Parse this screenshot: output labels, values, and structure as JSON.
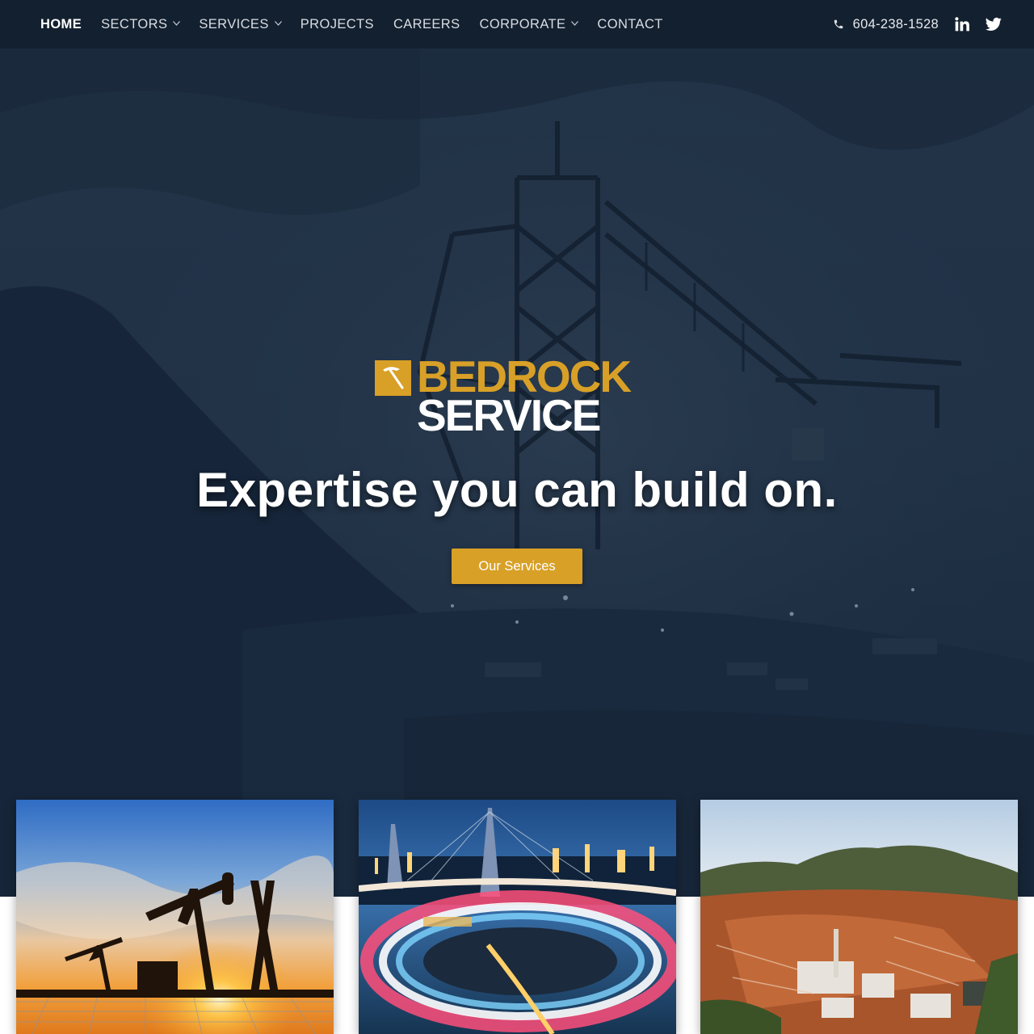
{
  "nav": {
    "items": [
      {
        "label": "HOME",
        "active": true,
        "has_dropdown": false
      },
      {
        "label": "SECTORS",
        "active": false,
        "has_dropdown": true
      },
      {
        "label": "SERVICES",
        "active": false,
        "has_dropdown": true
      },
      {
        "label": "PROJECTS",
        "active": false,
        "has_dropdown": false
      },
      {
        "label": "CAREERS",
        "active": false,
        "has_dropdown": false
      },
      {
        "label": "CORPORATE",
        "active": false,
        "has_dropdown": true
      },
      {
        "label": "CONTACT",
        "active": false,
        "has_dropdown": false
      }
    ],
    "phone": "604-238-1528",
    "phone_icon": "phone-icon",
    "social": [
      {
        "name": "linkedin-icon"
      },
      {
        "name": "twitter-icon"
      }
    ]
  },
  "hero": {
    "logo": {
      "line1": "BEDROCK",
      "line2": "SERVICE",
      "mark_icon": "pickaxe-icon"
    },
    "tagline": "Expertise you can build on.",
    "cta_label": "Our Services"
  },
  "cards": [
    {
      "image": "oil-pumpjacks-sunset"
    },
    {
      "image": "highway-interchange-night"
    },
    {
      "image": "mining-site-aerial"
    }
  ],
  "colors": {
    "nav_bg": "#13202f",
    "accent": "#d8a027",
    "hero_overlay": "#1c2d40",
    "text_light": "#ffffff"
  }
}
